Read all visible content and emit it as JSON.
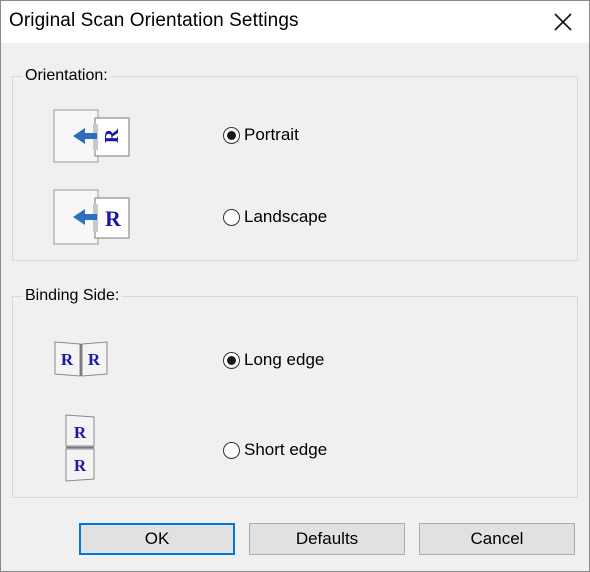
{
  "window": {
    "title": "Original Scan Orientation Settings"
  },
  "orientation": {
    "label": "Orientation:",
    "options": [
      {
        "label": "Portrait",
        "selected": true,
        "icon": "portrait-scan-icon"
      },
      {
        "label": "Landscape",
        "selected": false,
        "icon": "landscape-scan-icon"
      }
    ]
  },
  "binding": {
    "label": "Binding Side:",
    "options": [
      {
        "label": "Long edge",
        "selected": true,
        "icon": "long-edge-binding-icon"
      },
      {
        "label": "Short edge",
        "selected": false,
        "icon": "short-edge-binding-icon"
      }
    ]
  },
  "buttons": {
    "ok": "OK",
    "defaults": "Defaults",
    "cancel": "Cancel"
  },
  "icon_glyph": "R",
  "colors": {
    "accent": "#0078d7",
    "arrow": "#2f6fc0",
    "glyph": "#1a1aa8"
  }
}
